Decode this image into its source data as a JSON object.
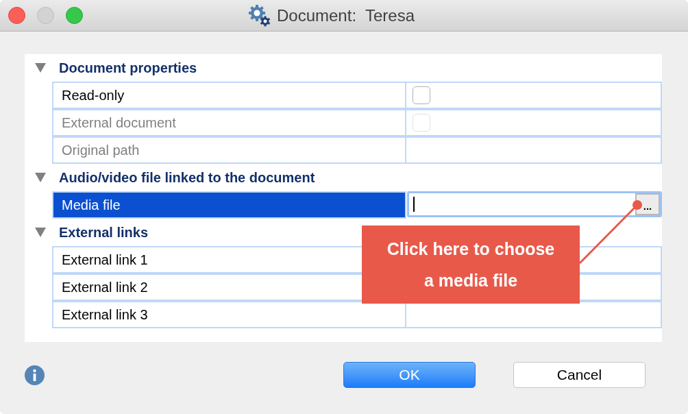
{
  "window": {
    "title": "Document:  Teresa"
  },
  "sections": [
    {
      "title": "Document properties",
      "expanded": true,
      "rows": [
        {
          "kind": "checkbox",
          "label": "Read-only",
          "disabled": false,
          "selected": false,
          "checked": false
        },
        {
          "kind": "checkbox",
          "label": "External document",
          "disabled": true,
          "selected": false,
          "checked": false
        },
        {
          "kind": "text",
          "label": "Original path",
          "disabled": true,
          "selected": false
        }
      ]
    },
    {
      "title": "Audio/video file linked to the document",
      "expanded": true,
      "rows": [
        {
          "kind": "file",
          "label": "Media file",
          "disabled": false,
          "selected": true,
          "browse": "..."
        }
      ]
    },
    {
      "title": "External links",
      "expanded": true,
      "rows": [
        {
          "kind": "text",
          "label": "External link 1",
          "disabled": false,
          "selected": false
        },
        {
          "kind": "text",
          "label": "External link 2",
          "disabled": false,
          "selected": false
        },
        {
          "kind": "text",
          "label": "External link 3",
          "disabled": false,
          "selected": false
        }
      ]
    }
  ],
  "callout": {
    "text": "Click here to choose a media file"
  },
  "buttons": [
    {
      "label": "OK",
      "kind": "primary"
    },
    {
      "label": "Cancel",
      "kind": "secondary"
    }
  ]
}
